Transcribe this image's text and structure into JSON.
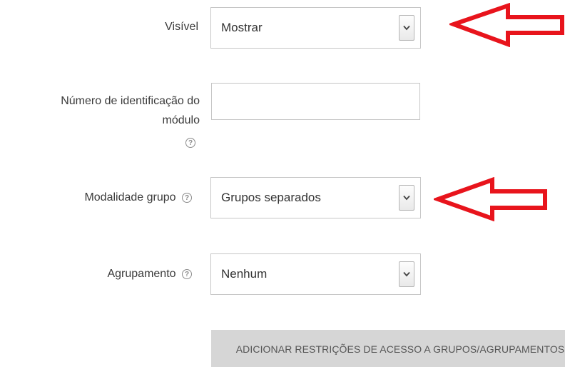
{
  "fields": {
    "visible": {
      "label": "Visível",
      "value": "Mostrar"
    },
    "id_number": {
      "label_line1": "Número de identificação do",
      "label_line2": "módulo",
      "value": ""
    },
    "group_mode": {
      "label": "Modalidade grupo",
      "value": "Grupos separados"
    },
    "grouping": {
      "label": "Agrupamento",
      "value": "Nenhum"
    }
  },
  "actions": {
    "add_restrictions_label": "ADICIONAR RESTRIÇÕES DE ACESSO A GRUPOS/AGRUPAMENTOS"
  },
  "annotations": {
    "arrow_color": "#e8141c"
  },
  "icons": {
    "help": "help-icon",
    "dropdown": "chevron-down-icon",
    "arrow": "left-arrow-icon"
  }
}
